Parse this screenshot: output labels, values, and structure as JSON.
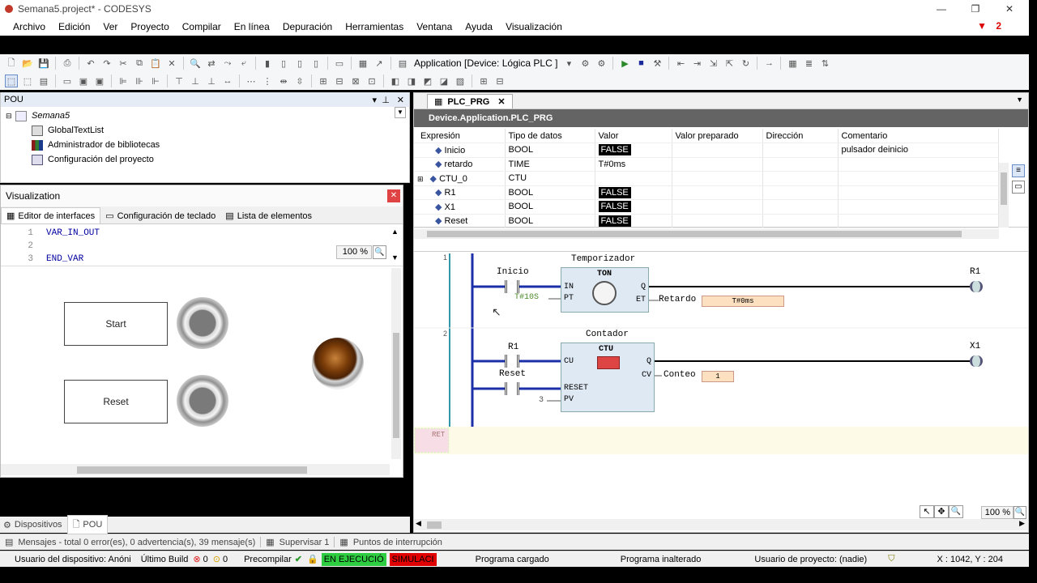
{
  "window": {
    "title": "Semana5.project* - CODESYS"
  },
  "menu": [
    "Archivo",
    "Edición",
    "Ver",
    "Proyecto",
    "Compilar",
    "En línea",
    "Depuración",
    "Herramientas",
    "Ventana",
    "Ayuda",
    "Visualización"
  ],
  "notify_count": "2",
  "toolbar": {
    "application": "Application [Device: Lógica PLC ]"
  },
  "pou_panel": {
    "title": "POU",
    "items": [
      "Semana5",
      "GlobalTextList",
      "Administrador de bibliotecas",
      "Configuración del proyecto"
    ]
  },
  "visualization": {
    "title": "Visualization",
    "tabs": [
      "Editor de interfaces",
      "Configuración de teclado",
      "Lista de elementos"
    ],
    "code": [
      {
        "n": "1",
        "t": "VAR_IN_OUT"
      },
      {
        "n": "2",
        "t": ""
      },
      {
        "n": "3",
        "t": "END_VAR"
      }
    ],
    "zoom": "100 %",
    "buttons": [
      "Start",
      "Reset"
    ]
  },
  "bottom_tabs": [
    "Dispositivos",
    "POU"
  ],
  "editor": {
    "tab": "PLC_PRG",
    "path": "Device.Application.PLC_PRG",
    "columns": [
      "Expresión",
      "Tipo de datos",
      "Valor",
      "Valor preparado",
      "Dirección",
      "Comentario"
    ],
    "rows": [
      {
        "expr": "Inicio",
        "type": "BOOL",
        "value": "FALSE",
        "comment": "pulsador deinicio",
        "bool": true
      },
      {
        "expr": "retardo",
        "type": "TIME",
        "value": "T#0ms",
        "comment": "",
        "bool": false
      },
      {
        "expr": "CTU_0",
        "type": "CTU",
        "value": "",
        "comment": "",
        "bool": false
      },
      {
        "expr": "R1",
        "type": "BOOL",
        "value": "FALSE",
        "comment": "",
        "bool": true
      },
      {
        "expr": "X1",
        "type": "BOOL",
        "value": "FALSE",
        "comment": "",
        "bool": true
      },
      {
        "expr": "Reset",
        "type": "BOOL",
        "value": "FALSE",
        "comment": "",
        "bool": true
      }
    ],
    "ladder": {
      "r1": {
        "num": "1",
        "contact": "Inicio",
        "pt": "T#10S",
        "block_title": "Temporizador",
        "block": "TON",
        "in": "IN",
        "ptpin": "PT",
        "q": "Q",
        "et": "ET",
        "et_var": "Retardo",
        "et_val": "T#0ms",
        "coil": "R1"
      },
      "r2": {
        "num": "2",
        "contact": "R1",
        "contact2": "Reset",
        "pv": "3",
        "block_title": "Contador",
        "block": "CTU",
        "cu": "CU",
        "reset": "RESET",
        "pvpin": "PV",
        "q": "Q",
        "cv": "CV",
        "cv_var": "Conteo",
        "cv_val": "1",
        "coil": "X1"
      },
      "ret": "RET"
    },
    "zoom": "100 %"
  },
  "messages": {
    "msg": "Mensajes - total 0 error(es), 0 advertencia(s), 39 mensaje(s)",
    "supervise": "Supervisar 1",
    "breakpoints": "Puntos de interrupción"
  },
  "status": {
    "device_user": "Usuario del dispositivo: Anóni",
    "last_build": "Último Build",
    "errors": "0",
    "warnings": "0",
    "precompile": "Precompilar",
    "running": "EN EJECUCIÓ",
    "simulation": "SIMULACI",
    "program_loaded": "Programa cargado",
    "program_unchanged": "Programa inalterado",
    "project_user": "Usuario de proyecto: (nadie)",
    "coords": "X : 1042, Y : 204"
  },
  "colors": {
    "running": "#2ecc40",
    "simulation": "#e00000",
    "header": "#646464"
  }
}
